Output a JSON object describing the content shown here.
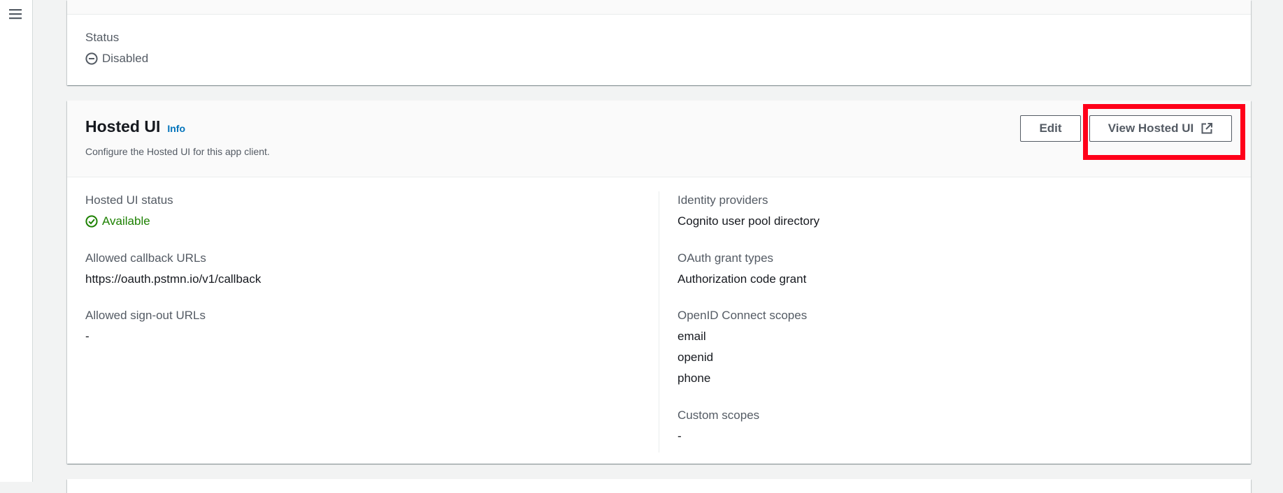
{
  "top_panel": {
    "status_label": "Status",
    "status_value": "Disabled"
  },
  "hosted_ui": {
    "title": "Hosted UI",
    "info_link": "Info",
    "description": "Configure the Hosted UI for this app client.",
    "edit_button": "Edit",
    "view_button": "View Hosted UI",
    "left_column": {
      "status_label": "Hosted UI status",
      "status_value": "Available",
      "callback_label": "Allowed callback URLs",
      "callback_value": "https://oauth.pstmn.io/v1/callback",
      "signout_label": "Allowed sign-out URLs",
      "signout_value": "-"
    },
    "right_column": {
      "idp_label": "Identity providers",
      "idp_value": "Cognito user pool directory",
      "grant_label": "OAuth grant types",
      "grant_value": "Authorization code grant",
      "scopes_label": "OpenID Connect scopes",
      "scopes": [
        "email",
        "openid",
        "phone"
      ],
      "custom_label": "Custom scopes",
      "custom_value": "-"
    }
  },
  "icons": {
    "menu": "hamburger-menu-icon",
    "disabled": "minus-circle-icon",
    "available": "check-circle-icon",
    "external": "external-link-icon"
  },
  "colors": {
    "available_green": "#1d8102",
    "link_blue": "#0073bb",
    "highlight_red": "#ff0019"
  }
}
